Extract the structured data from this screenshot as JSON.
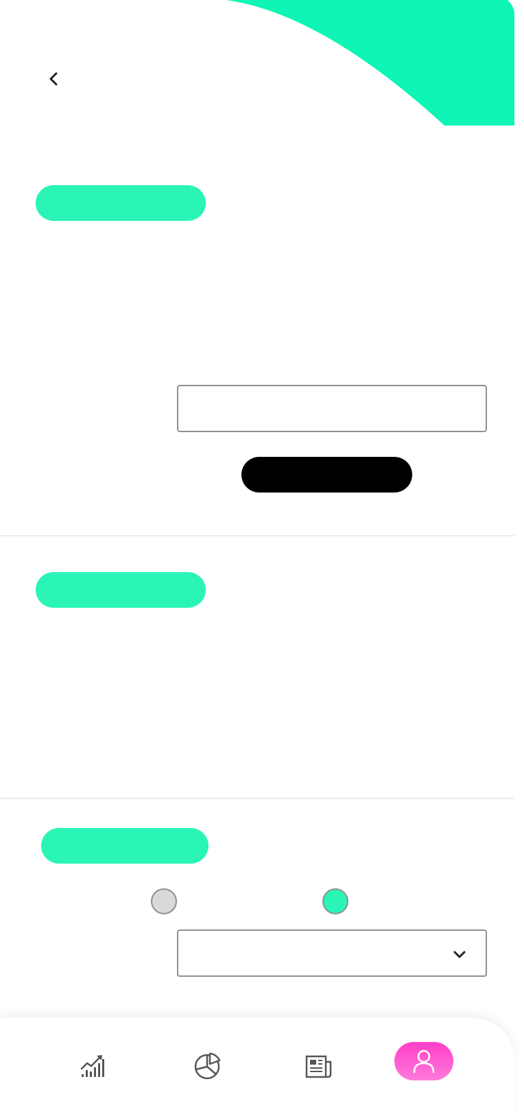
{
  "header": {
    "back_icon": "chevron-left-icon",
    "accent_color": "#0ef5b6"
  },
  "sections": [
    {
      "pill_color": "#2af5b6"
    },
    {
      "pill_color": "#2af5b6"
    },
    {
      "pill_color": "#2af5b6"
    }
  ],
  "form": {
    "input_value": "",
    "input_placeholder": "",
    "submit_label": ""
  },
  "options": {
    "radio_1_selected": false,
    "radio_2_selected": true,
    "select_value": "",
    "select_icon": "chevron-down-icon"
  },
  "bottom_nav": {
    "items": [
      {
        "icon": "stats-chart-icon",
        "active": false
      },
      {
        "icon": "pie-chart-icon",
        "active": false
      },
      {
        "icon": "newspaper-icon",
        "active": false
      },
      {
        "icon": "profile-icon",
        "active": true
      }
    ],
    "active_color": "#ff45c8"
  }
}
